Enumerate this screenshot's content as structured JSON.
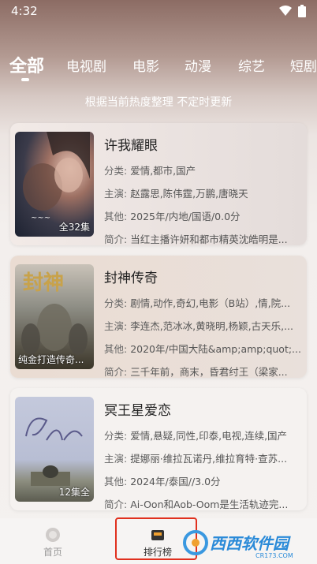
{
  "status": {
    "time": "4:32"
  },
  "tabs": [
    {
      "label": "全部",
      "active": true
    },
    {
      "label": "电视剧"
    },
    {
      "label": "电影"
    },
    {
      "label": "动漫"
    },
    {
      "label": "综艺"
    },
    {
      "label": "短剧"
    }
  ],
  "subtitle": "根据当前热度整理 不定时更新",
  "cards": [
    {
      "title": "许我耀眼",
      "genre_label": "分类:",
      "genre": "爱情,都市,国产",
      "cast_label": "主演:",
      "cast": "赵露思,陈伟霆,万鹏,唐晓天",
      "other_label": "其他:",
      "other": "2025年/内地/国语/0.0分",
      "intro_label": "简介:",
      "intro": "当红主播许妍和都市精英沈皓明是...",
      "poster_badge": "全32集",
      "poster_caption": ""
    },
    {
      "title": "封神传奇",
      "genre_label": "分类:",
      "genre": "剧情,动作,奇幻,电影（B站）,情,院...",
      "cast_label": "主演:",
      "cast": "李连杰,范冰冰,黄晓明,杨颖,古天乐,...",
      "other_label": "其他:",
      "other": "2020年/中国大陆&amp;amp;quot;...",
      "intro_label": "简介:",
      "intro": "三千年前，商末，昏君纣王（梁家...",
      "poster_badge": "",
      "poster_caption": "纯金打造传奇..."
    },
    {
      "title": "冥王星爱恋",
      "genre_label": "分类:",
      "genre": "爱情,悬疑,同性,印泰,电视,连续,国产",
      "cast_label": "主演:",
      "cast": "提娜丽·维拉瓦诺丹,维拉育特·查苏...",
      "other_label": "其他:",
      "other": "2024年/泰国//3.0分",
      "intro_label": "简介:",
      "intro": "Ai-Oon和Aob-Oom是生活轨迹完...",
      "poster_badge": "12集全",
      "poster_caption": ""
    }
  ],
  "nav": [
    {
      "label": "首页"
    },
    {
      "label": "排行榜",
      "active": true
    }
  ],
  "watermark": {
    "text": "西西软件园",
    "sub": "CR173.COM"
  },
  "colors": {
    "highlight": "#e0301e",
    "tab_text": "#ffffff"
  }
}
